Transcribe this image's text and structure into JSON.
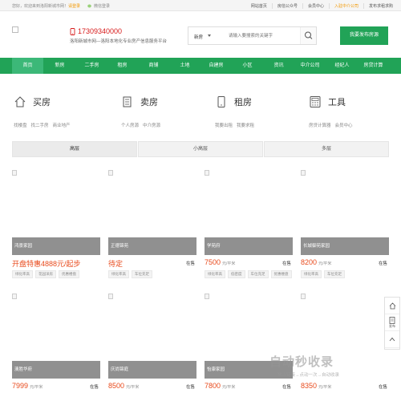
{
  "topbar": {
    "welcome": "您好，欢迎来到洛阳新城市网！",
    "register": "请登录",
    "wechat_login": "微信登录",
    "links": [
      "网站首页",
      "房信公众号",
      "会员中心",
      "入驻中介公司",
      "发布求租求购"
    ]
  },
  "header": {
    "phone": "17309340000",
    "slogan": "洛阳新城市网—洛阳本地化专业房产信息服务平台",
    "search_category": "新房",
    "search_placeholder": "请输入要搜索的关键字",
    "publish_button": "我要发布房源"
  },
  "nav": {
    "items": [
      "首页",
      "新房",
      "二手房",
      "租房",
      "商铺",
      "土地",
      "自建房",
      "小区",
      "资讯",
      "中介公司",
      "经纪人",
      "房贷计算"
    ]
  },
  "categories": [
    {
      "title": "买房",
      "icon": "house-icon",
      "subs": [
        "找楼盘",
        "找二手房",
        "商业地产"
      ]
    },
    {
      "title": "卖房",
      "icon": "building-icon",
      "subs": [
        "个人房源",
        "中介房源"
      ]
    },
    {
      "title": "租房",
      "icon": "phone-icon",
      "subs": [
        "我要出租",
        "我要求租"
      ]
    },
    {
      "title": "工具",
      "icon": "calculator-icon",
      "subs": [
        "房贷计算器",
        "会员中心"
      ]
    }
  ],
  "tabs": [
    "高层",
    "小高层",
    "多层"
  ],
  "listings": [
    {
      "name": "鸿景家园",
      "price": "开盘特惠4888元/起步",
      "unit": "",
      "status": "",
      "tags": [
        "绿化率高",
        "花园洋房",
        "优惠楼盘"
      ]
    },
    {
      "name": "正德锦苑",
      "price": "待定",
      "unit": "",
      "status": "在售",
      "tags": [
        "绿化率高",
        "车位充足"
      ]
    },
    {
      "name": "学苑府",
      "price": "7500",
      "unit": "元/平米",
      "status": "在售",
      "tags": [
        "绿化率高",
        "低密度",
        "车位充足",
        "优惠楼盘"
      ]
    },
    {
      "name": "长城御苑家园",
      "price": "8200",
      "unit": "元/平米",
      "status": "在售",
      "tags": [
        "绿化率高",
        "车位充足"
      ]
    },
    {
      "name": "澳胜华府",
      "price": "7999",
      "unit": "元/平米",
      "status": "在售",
      "tags": []
    },
    {
      "name": "庆尚锦庭",
      "price": "8500",
      "unit": "元/平米",
      "status": "在售",
      "tags": []
    },
    {
      "name": "怡康家园",
      "price": "7800",
      "unit": "元/平米",
      "status": "在售",
      "tags": []
    },
    {
      "name": "",
      "price": "8350",
      "unit": "元/平米",
      "status": "在售",
      "tags": []
    }
  ],
  "sidebar": {
    "publish": "发布"
  },
  "watermark": {
    "title": "自动秒收录",
    "sub": "数上链接→点动一次→自动收录"
  },
  "colors": {
    "brand": "#21a357",
    "price": "#e84a1c",
    "hotline": "#d71b1b"
  }
}
